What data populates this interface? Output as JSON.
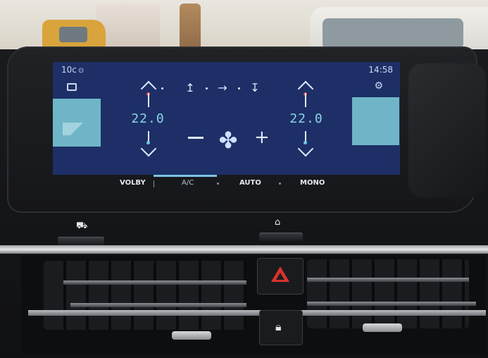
{
  "status": {
    "outside_temp": "10c",
    "time": "14:58"
  },
  "zones": {
    "left": {
      "temperature": "22.0"
    },
    "right": {
      "temperature": "22.0"
    }
  },
  "icons": {
    "location": "map-pin-icon",
    "recirculation": "recirculation-icon",
    "settings": "fan-settings-icon",
    "airflow_face": "airflow-face-icon",
    "airflow_body": "airflow-body-icon",
    "airflow_feet": "airflow-feet-icon",
    "fan": "fan-icon",
    "car": "car-icon",
    "home": "home-icon",
    "hazard": "hazard-icon",
    "lock": "lock-icon"
  },
  "fan_controls": {
    "minus": "−",
    "plus": "+"
  },
  "mode_bar": {
    "volby": "VOLBY",
    "ac": "A/C",
    "auto": "AUTO",
    "mono": "MONO"
  },
  "colors": {
    "screen_bg": "#1d2f66",
    "seat_tile": "#6fb5c7",
    "temp_text": "#8ad4e6",
    "ac_indicator": "#7cc4e3",
    "hazard_red": "#d8322d"
  }
}
